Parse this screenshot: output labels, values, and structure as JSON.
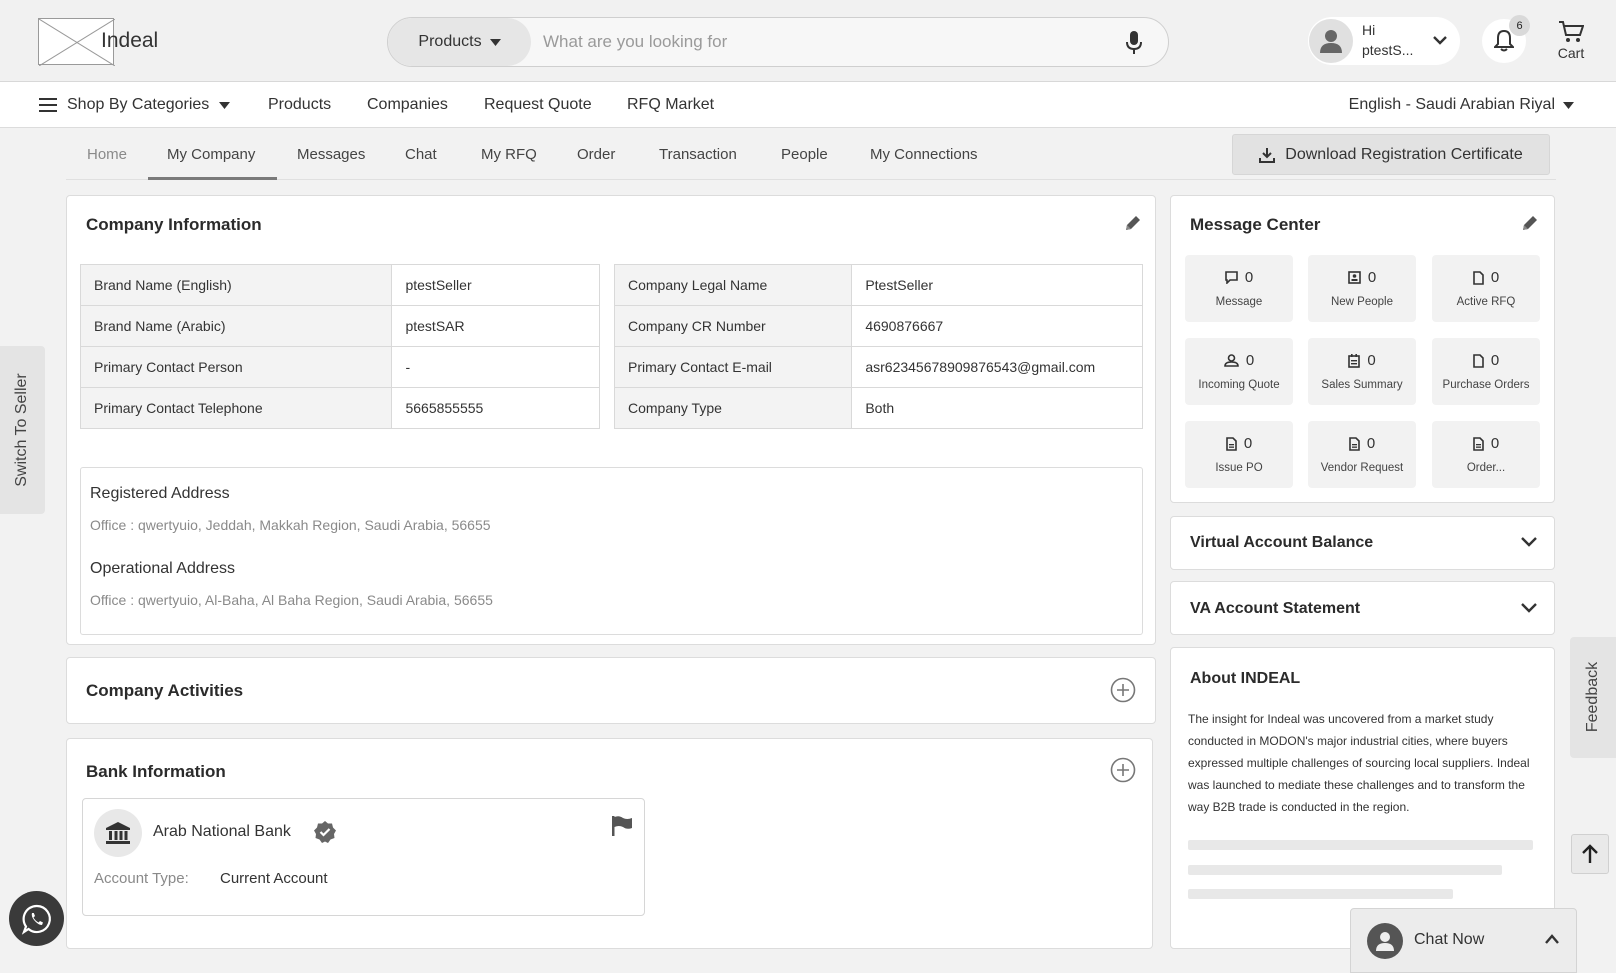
{
  "header": {
    "brand": "Indeal",
    "search_category": "Products",
    "search_placeholder": "What are you looking for",
    "greeting": "Hi",
    "username": "ptestS...",
    "notification_count": "6",
    "cart_label": "Cart"
  },
  "nav": {
    "categories": "Shop By Categories",
    "items": [
      "Products",
      "Companies",
      "Request Quote",
      "RFQ Market"
    ],
    "language": "English - Saudi Arabian Riyal"
  },
  "tabs": {
    "items": [
      "Home",
      "My Company",
      "Messages",
      "Chat",
      "My RFQ",
      "Order",
      "Transaction",
      "People",
      "My Connections"
    ],
    "active": "My Company",
    "download_label": "Download Registration Certificate"
  },
  "company_info": {
    "title": "Company Information",
    "left": [
      {
        "key": "Brand Name (English)",
        "value": "ptestSeller"
      },
      {
        "key": "Brand Name (Arabic)",
        "value": "ptestSAR"
      },
      {
        "key": "Primary Contact Person",
        "value": "-"
      },
      {
        "key": "Primary Contact Telephone",
        "value": "5665855555"
      }
    ],
    "right": [
      {
        "key": "Company Legal Name",
        "value": "PtestSeller"
      },
      {
        "key": "Company CR Number",
        "value": "4690876667"
      },
      {
        "key": "Primary Contact E-mail",
        "value": "asr62345678909876543@gmail.com"
      },
      {
        "key": "Company Type",
        "value": "Both"
      }
    ],
    "registered_address_label": "Registered Address",
    "registered_address": "Office : qwertyuio, Jeddah, Makkah Region, Saudi Arabia, 56655",
    "operational_address_label": "Operational Address",
    "operational_address": "Office : qwertyuio, Al-Baha, Al Baha Region, Saudi Arabia, 56655"
  },
  "company_activities": {
    "title": "Company Activities"
  },
  "bank_info": {
    "title": "Bank Information",
    "bank_name": "Arab National Bank",
    "account_type_label": "Account Type:",
    "account_type": "Current Account"
  },
  "message_center": {
    "title": "Message Center",
    "tiles": [
      {
        "icon": "chat-icon",
        "count": "0",
        "label": "Message"
      },
      {
        "icon": "id-card-icon",
        "count": "0",
        "label": "New People"
      },
      {
        "icon": "document-icon",
        "count": "0",
        "label": "Active RFQ"
      },
      {
        "icon": "person-icon",
        "count": "0",
        "label": "Incoming Quote"
      },
      {
        "icon": "calendar-icon",
        "count": "0",
        "label": "Sales Summary"
      },
      {
        "icon": "document-icon",
        "count": "0",
        "label": "Purchase Orders"
      },
      {
        "icon": "document-icon",
        "count": "0",
        "label": "Issue PO"
      },
      {
        "icon": "document-icon",
        "count": "0",
        "label": "Vendor Request"
      },
      {
        "icon": "document-icon",
        "count": "0",
        "label": "Order..."
      }
    ]
  },
  "virtual_account": {
    "title": "Virtual Account Balance"
  },
  "va_statement": {
    "title": "VA Account Statement"
  },
  "about": {
    "title": "About INDEAL",
    "text": "The insight for Indeal was uncovered from a market study conducted in MODON's major industrial cities, where buyers expressed multiple challenges of sourcing local suppliers. Indeal was launched to mediate these challenges and to transform the way B2B trade is conducted in the region."
  },
  "side": {
    "switch_label": "Switch To Seller",
    "feedback_label": "Feedback",
    "chat_now": "Chat Now"
  }
}
